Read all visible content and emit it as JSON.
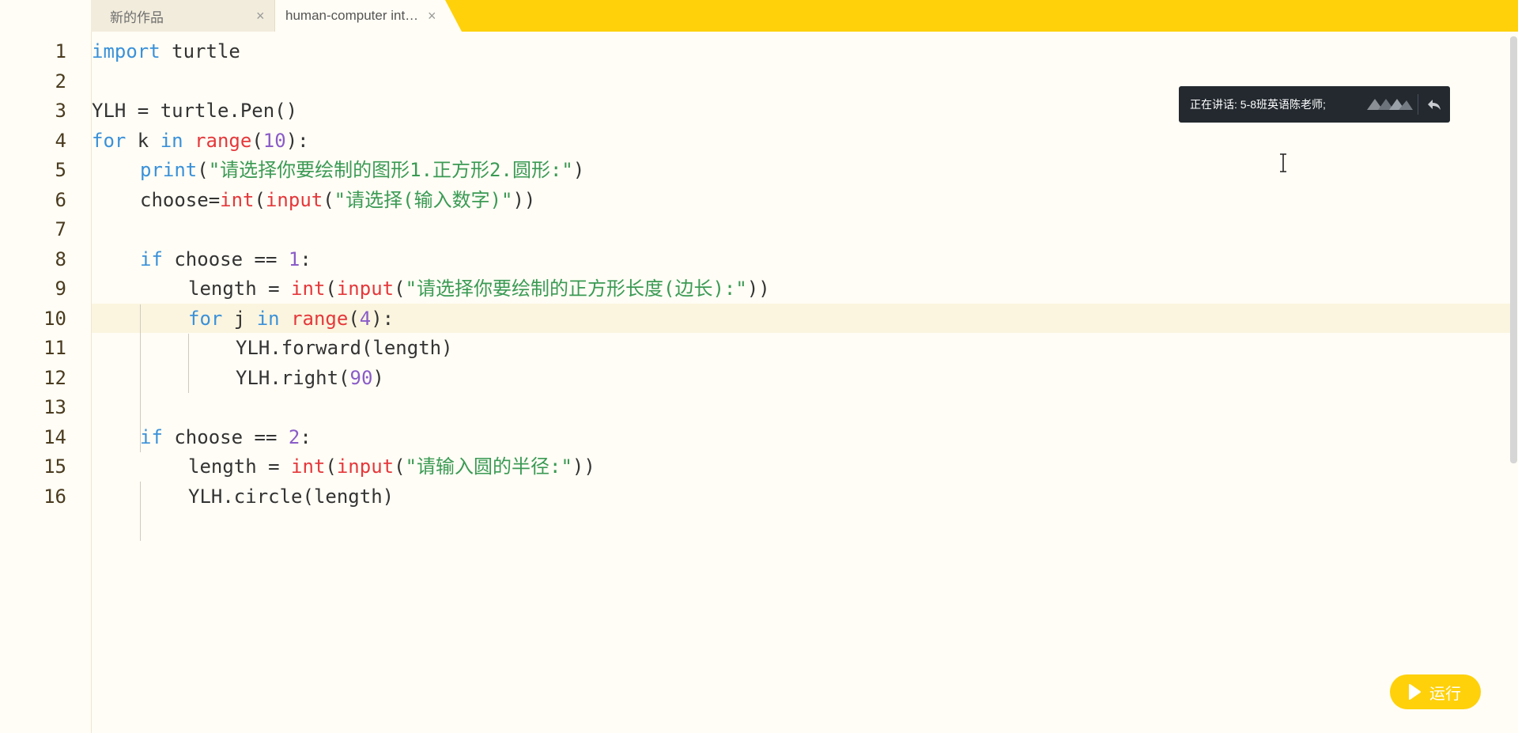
{
  "tabs": [
    {
      "label": "新的作品",
      "close": "×",
      "active": false
    },
    {
      "label": "human-computer int…",
      "close": "×",
      "active": true
    }
  ],
  "line_numbers": [
    "1",
    "2",
    "3",
    "4",
    "5",
    "6",
    "7",
    "8",
    "9",
    "10",
    "11",
    "12",
    "13",
    "14",
    "15",
    "16"
  ],
  "notification": {
    "text": "正在讲话: 5-8班英语陈老师;",
    "icon": "reply-icon"
  },
  "run_button": {
    "label": "运行",
    "icon": "play-icon"
  },
  "colors": {
    "accent": "#fed10b",
    "keyword": "#3a91d9",
    "builtin": "#e5383b",
    "number": "#8a5cc8",
    "string": "#3a9a54"
  },
  "code": {
    "l1": {
      "kw": "import",
      "rest": " turtle"
    },
    "l3": {
      "text": "YLH = turtle.Pen()"
    },
    "l4": {
      "kw": "for",
      "a": " k ",
      "kw2": "in",
      "sp": " ",
      "fn": "range",
      "p1": "(",
      "num": "10",
      "p2": "):"
    },
    "l5": {
      "kw": "print",
      "p1": "(",
      "str": "\"请选择你要绘制的图形1.正方形2.圆形:\"",
      "p2": ")"
    },
    "l6": {
      "a": "choose=",
      "fn1": "int",
      "p1": "(",
      "fn2": "input",
      "p2": "(",
      "str": "\"请选择(输入数字)\"",
      "p3": "))"
    },
    "l8": {
      "kw": "if",
      "a": " choose == ",
      "num": "1",
      "p": ":"
    },
    "l9": {
      "a": "length = ",
      "fn1": "int",
      "p1": "(",
      "fn2": "input",
      "p2": "(",
      "str": "\"请选择你要绘制的正方形长度(边长):\"",
      "p3": "))"
    },
    "l10": {
      "kw": "for",
      "a": " j ",
      "kw2": "in",
      "sp": " ",
      "fn": "range",
      "p1": "(",
      "num": "4",
      "p2": "):"
    },
    "l11": {
      "text": "YLH.forward(length)"
    },
    "l12": {
      "a": "YLH.right(",
      "num": "90",
      "p": ")"
    },
    "l14": {
      "kw": "if",
      "a": " choose == ",
      "num": "2",
      "p": ":"
    },
    "l15": {
      "a": "length = ",
      "fn1": "int",
      "p1": "(",
      "fn2": "input",
      "p2": "(",
      "str": "\"请输入圆的半径:\"",
      "p3": "))"
    },
    "l16": {
      "text": "YLH.circle(length)"
    }
  }
}
